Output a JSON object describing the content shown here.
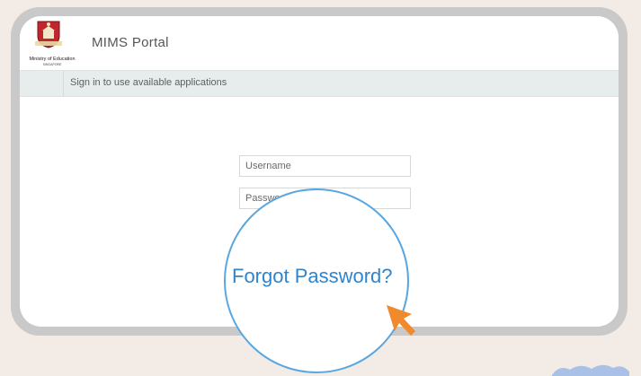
{
  "header": {
    "org_name": "Ministry of Education",
    "org_sub": "SINGAPORE",
    "portal_title": "MIMS Portal"
  },
  "subbar": {
    "text": "Sign in to use available applications"
  },
  "form": {
    "username_placeholder": "Username",
    "password_placeholder": "Password",
    "forgot_label": "Forgot Password?"
  },
  "icons": {
    "crest": "moe-crest-icon",
    "cursor": "mouse-pointer-icon"
  },
  "colors": {
    "accent": "#2f84cc",
    "magnifier_ring": "#5aa7e0",
    "cursor": "#f08a2c",
    "crest_red": "#c0272d"
  }
}
